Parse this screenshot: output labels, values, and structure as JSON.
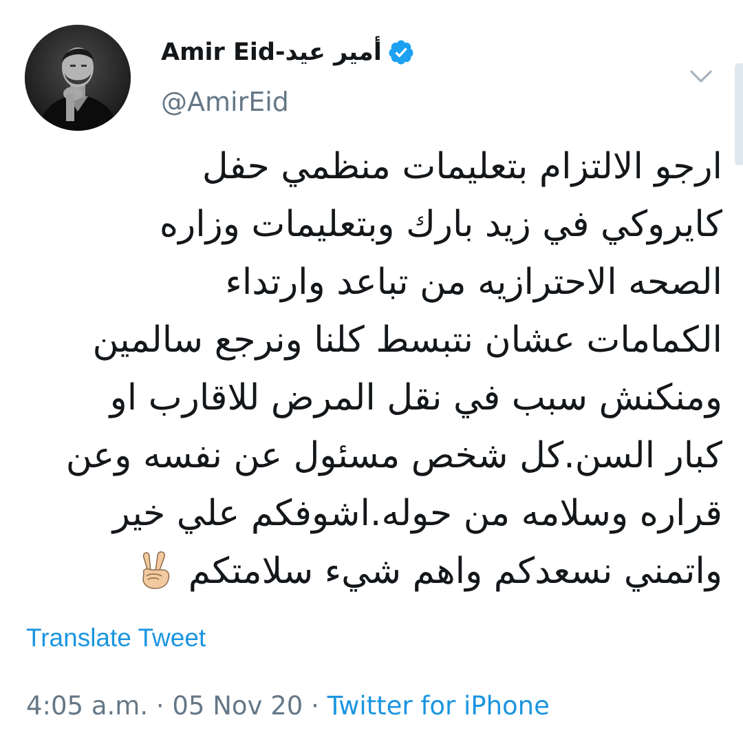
{
  "user": {
    "display_name": "Amir Eid-أمير عيد",
    "handle": "@AmirEid",
    "verified": true,
    "avatar_icon": "profile-photo"
  },
  "tweet": {
    "lines": [
      "ارجو الالتزام بتعليمات منظمي حفل",
      "كايروكي في زيد بارك وبتعليمات وزاره",
      "الصحه الاحترازيه من تباعد وارتداء",
      "الكمامات عشان نتبسط كلنا ونرجع سالمين",
      "ومنكنش سبب في نقل المرض للاقارب او",
      "كبار السن.كل شخص مسئول عن نفسه وعن",
      "قراره وسلامه من حوله.اشوفكم علي خير"
    ],
    "last_line": "واتمني نسعدكم واهم شيء سلامتكم",
    "emoji": "victory-hand-icon"
  },
  "actions": {
    "translate_label": "Translate Tweet",
    "menu_icon": "chevron-down-icon"
  },
  "meta": {
    "time": "4:05 a.m.",
    "separator": "·",
    "date": "05 Nov 20",
    "source": "Twitter for iPhone"
  },
  "colors": {
    "link": "#1b95e0",
    "secondary_text": "#657786",
    "verified_badge": "#1da1f2",
    "primary_text": "#14171a"
  }
}
